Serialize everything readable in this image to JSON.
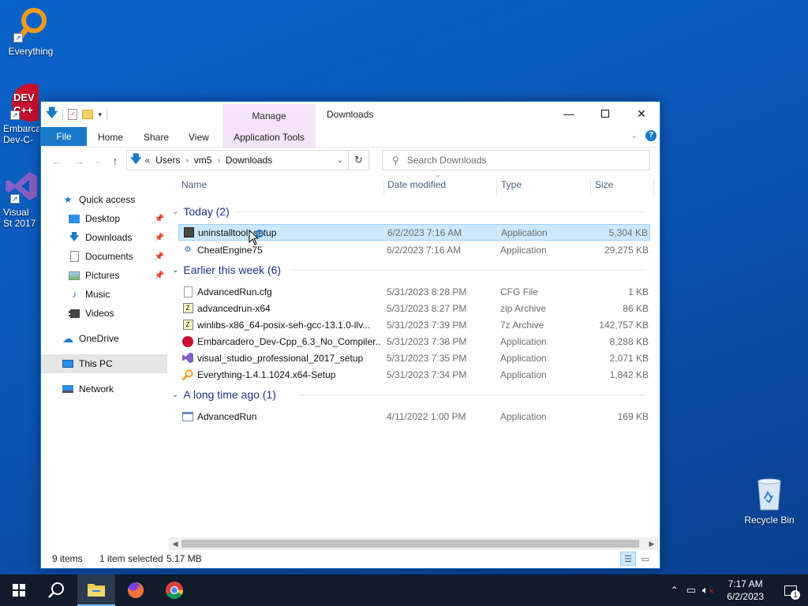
{
  "desktop": {
    "icons": [
      {
        "label": "Everything"
      },
      {
        "label": "Embarca Dev-C-"
      },
      {
        "label": "Visual St 2017"
      },
      {
        "label": "Recycle Bin"
      }
    ]
  },
  "window": {
    "title": "Downloads",
    "manage_label": "Manage",
    "ribbon_tabs": [
      "File",
      "Home",
      "Share",
      "View",
      "Application Tools"
    ],
    "address": {
      "overflow": "«",
      "crumbs": [
        "Users",
        "vm5",
        "Downloads"
      ]
    },
    "search_placeholder": "Search Downloads"
  },
  "navpane": {
    "items": [
      {
        "label": "Quick access"
      },
      {
        "label": "Desktop"
      },
      {
        "label": "Downloads"
      },
      {
        "label": "Documents"
      },
      {
        "label": "Pictures"
      },
      {
        "label": "Music"
      },
      {
        "label": "Videos"
      },
      {
        "label": "OneDrive"
      },
      {
        "label": "This PC"
      },
      {
        "label": "Network"
      }
    ]
  },
  "columns": {
    "name": "Name",
    "date": "Date modified",
    "type": "Type",
    "size": "Size"
  },
  "groups": [
    {
      "title": "Today (2)",
      "files": [
        {
          "name": "uninstalltool_setup",
          "date": "6/2/2023 7:16 AM",
          "type": "Application",
          "size": "5,304 KB"
        },
        {
          "name": "CheatEngine75",
          "date": "6/2/2023 7:16 AM",
          "type": "Application",
          "size": "29,275 KB"
        }
      ]
    },
    {
      "title": "Earlier this week (6)",
      "files": [
        {
          "name": "AdvancedRun.cfg",
          "date": "5/31/2023 8:28 PM",
          "type": "CFG File",
          "size": "1 KB"
        },
        {
          "name": "advancedrun-x64",
          "date": "5/31/2023 8:27 PM",
          "type": "zip Archive",
          "size": "86 KB"
        },
        {
          "name": "winlibs-x86_64-posix-seh-gcc-13.1.0-llv...",
          "date": "5/31/2023 7:39 PM",
          "type": "7z Archive",
          "size": "142,757 KB"
        },
        {
          "name": "Embarcadero_Dev-Cpp_6.3_No_Compiler...",
          "date": "5/31/2023 7:38 PM",
          "type": "Application",
          "size": "8,288 KB"
        },
        {
          "name": "visual_studio_professional_2017_setup",
          "date": "5/31/2023 7:35 PM",
          "type": "Application",
          "size": "2,071 KB"
        },
        {
          "name": "Everything-1.4.1.1024.x64-Setup",
          "date": "5/31/2023 7:34 PM",
          "type": "Application",
          "size": "1,842 KB"
        }
      ]
    },
    {
      "title": "A long time ago (1)",
      "files": [
        {
          "name": "AdvancedRun",
          "date": "4/11/2022 1:00 PM",
          "type": "Application",
          "size": "169 KB"
        }
      ]
    }
  ],
  "status": {
    "count": "9 items",
    "selected": "1 item selected",
    "size": "5.17 MB"
  },
  "taskbar": {
    "time": "7:17 AM",
    "date": "6/2/2023",
    "notification_count": "1"
  }
}
